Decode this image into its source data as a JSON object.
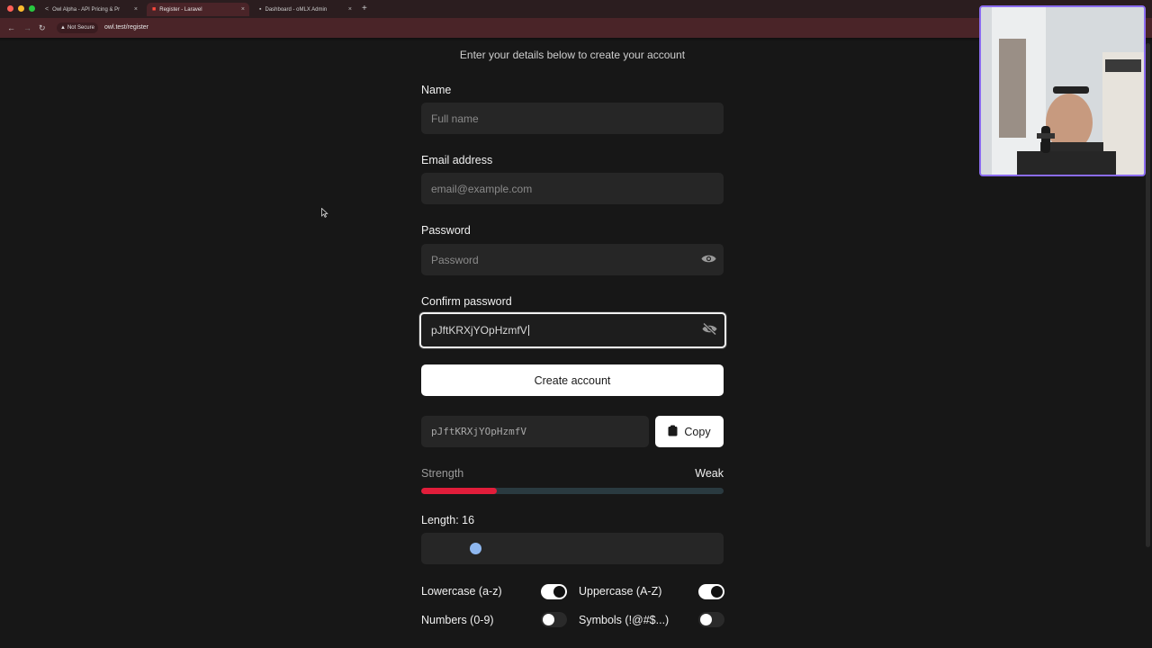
{
  "browser": {
    "tabs": [
      {
        "title": "Owl Alpha - API Pricing & Pr",
        "active": false
      },
      {
        "title": "Register - Laravel",
        "active": true
      },
      {
        "title": "Dashboard - oMLX Admin",
        "active": false
      }
    ],
    "security_label": "Not Secure",
    "url": "owl.test/register"
  },
  "form": {
    "subtitle": "Enter your details below to create your account",
    "name": {
      "label": "Name",
      "placeholder": "Full name"
    },
    "email": {
      "label": "Email address",
      "placeholder": "email@example.com"
    },
    "password": {
      "label": "Password",
      "placeholder": "Password"
    },
    "confirm": {
      "label": "Confirm password",
      "value": "pJftKRXjYOpHzmfV"
    },
    "submit_label": "Create account"
  },
  "generator": {
    "generated_password": "pJftKRXjYOpHzmfV",
    "copy_label": "Copy",
    "strength_label": "Strength",
    "strength_value": "Weak",
    "strength_fraction": 0.25,
    "length_label": "Length: 16",
    "length_fraction": 0.18,
    "options": [
      {
        "label": "Lowercase (a-z)",
        "enabled": true
      },
      {
        "label": "Uppercase (A-Z)",
        "enabled": true
      },
      {
        "label": "Numbers (0-9)",
        "enabled": false
      },
      {
        "label": "Symbols (!@#$...)",
        "enabled": false
      }
    ]
  },
  "colors": {
    "strength_weak": "#e11d3a",
    "slider_thumb": "#8fb8f0",
    "webcam_border": "#8b6cf0"
  }
}
